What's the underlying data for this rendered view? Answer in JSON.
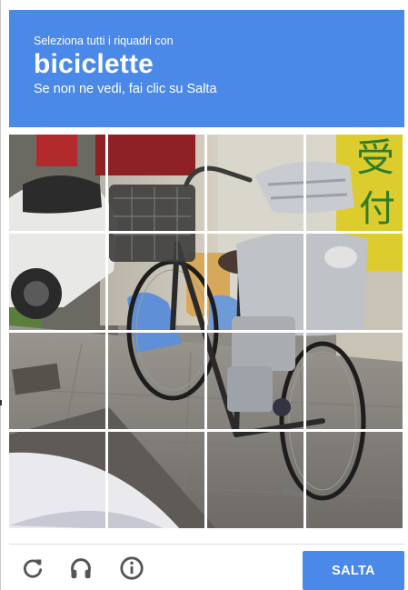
{
  "header": {
    "instruction": "Seleziona tutti i riquadri con",
    "target": "biciclette",
    "hint": "Se non ne vedi, fai clic su Salta"
  },
  "grid": {
    "rows": 4,
    "columns": 4
  },
  "footer": {
    "reload_icon": "reload-icon",
    "audio_icon": "headphones-icon",
    "info_icon": "info-icon",
    "skip_label": "SALTA"
  },
  "colors": {
    "accent": "#4a89e8",
    "icon_gray": "#555555",
    "divider": "#dedede"
  }
}
